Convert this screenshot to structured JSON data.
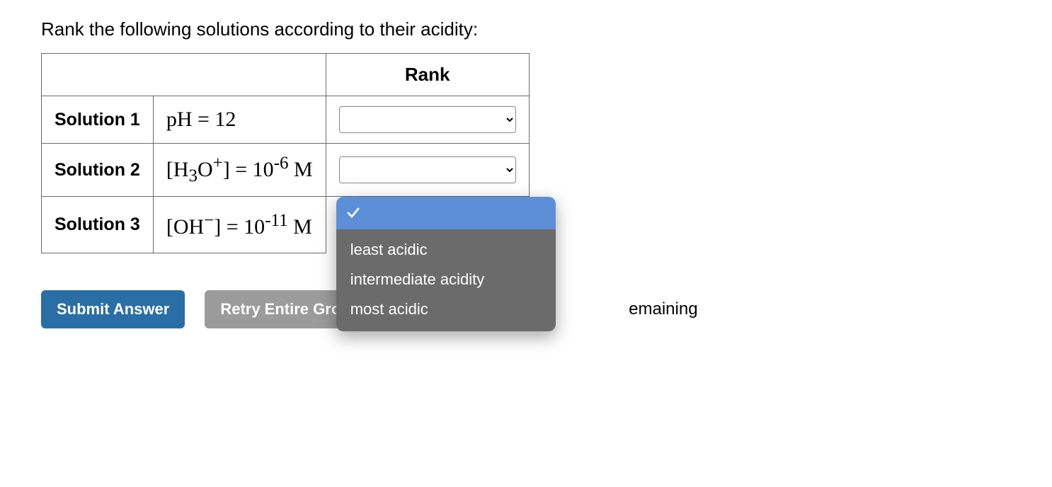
{
  "prompt": "Rank the following solutions according to their acidity:",
  "table": {
    "header_rank": "Rank",
    "rows": [
      {
        "label": "Solution 1",
        "formula_html": "pH = 12"
      },
      {
        "label": "Solution 2",
        "formula_html": "[H<sub>3</sub>O<sup>+</sup>] = 10<sup>-6</sup> M"
      },
      {
        "label": "Solution 3",
        "formula_html": "[OH<sup>−</sup>] = 10<sup>-11</sup> M"
      }
    ]
  },
  "dropdown": {
    "options": [
      "least acidic",
      "intermediate acidity",
      "most acidic"
    ]
  },
  "buttons": {
    "submit": "Submit Answer",
    "retry": "Retry Entire Group"
  },
  "remaining_fragment": "emaining"
}
